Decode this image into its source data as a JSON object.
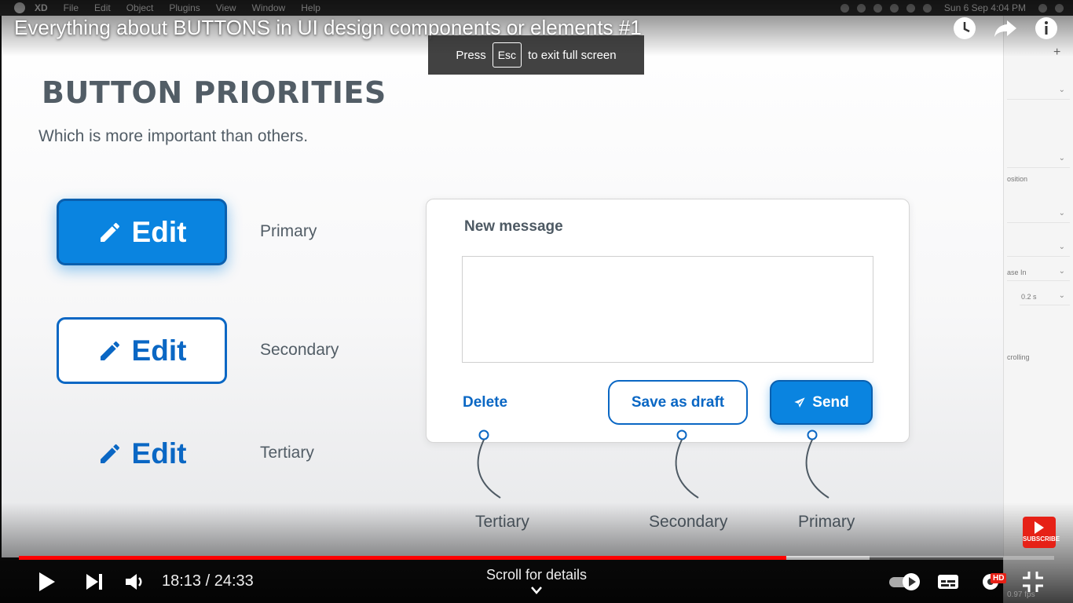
{
  "menubar": {
    "items": [
      "XD",
      "File",
      "Edit",
      "Object",
      "Plugins",
      "View",
      "Window",
      "Help"
    ],
    "datetime": "Sun 6 Sep  4:04 PM"
  },
  "video": {
    "title": "Everything about BUTTONS in UI design components or elements #1",
    "fullscreen_notice": {
      "press": "Press",
      "key": "Esc",
      "rest": "to exit full screen"
    },
    "time_current": "18:13",
    "time_total": "24:33",
    "time_display": "18:13 / 24:33",
    "progress_played_pct": 74.1,
    "progress_buffered_pct": 82.2,
    "scroll_hint": "Scroll for details",
    "quality_badge": "HD",
    "subscribe_label": "SUBSCRIBE",
    "fps_text": "0.97 fps",
    "accent_color": "#ff0000"
  },
  "slide": {
    "heading": "BUTTON PRIORITIES",
    "subheading": "Which is more important than others.",
    "edit_button_label": "Edit",
    "priorities": [
      {
        "label": "Primary",
        "style": "filled"
      },
      {
        "label": "Secondary",
        "style": "outlined"
      },
      {
        "label": "Tertiary",
        "style": "text"
      }
    ],
    "brand_color": "#0a84e0",
    "message_card": {
      "title": "New message",
      "delete_label": "Delete",
      "draft_label": "Save as draft",
      "send_label": "Send"
    },
    "annotation_labels": [
      "Tertiary",
      "Secondary",
      "Primary"
    ]
  },
  "xd_panel": {
    "labels": [
      "osition",
      "ase In",
      "0.2 s",
      "crolling"
    ]
  }
}
